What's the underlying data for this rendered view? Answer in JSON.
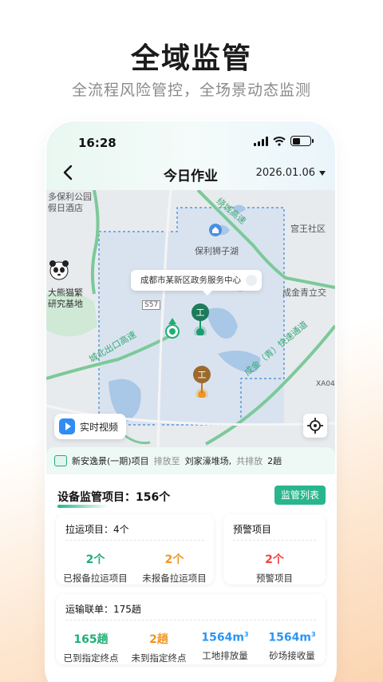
{
  "hero": {
    "title": "全域监管",
    "subtitle": "全流程风险管控，全场景动态监测"
  },
  "status_bar": {
    "time": "16:28"
  },
  "nav": {
    "title": "今日作业",
    "date": "2026.01.06"
  },
  "map": {
    "labels": [
      "多保利公园",
      "假日酒店",
      "绕城高速",
      "宫王社区",
      "保利狮子湖",
      "大熊猫繁",
      "研究基地",
      "成金青立交",
      "S57",
      "城北出口高速",
      "成金（青）快速通道",
      "XA04"
    ],
    "site_name": "成都市某新区政务服务中心",
    "marker_glyph": "工",
    "video_button": "实时视频"
  },
  "notice": {
    "project": "新安逸景(一期)项目",
    "dest_prefix": "排放至",
    "dest": "刘家濠堆场,",
    "count_prefix": "共排放",
    "count": "2趟"
  },
  "summary": {
    "title": "设备监管项目：156个",
    "list_button": "监管列表"
  },
  "transport_card": {
    "title": "拉运项目：4个",
    "metrics": [
      {
        "value": "2个",
        "label": "已报备拉运项目"
      },
      {
        "value": "2个",
        "label": "未报备拉运项目"
      }
    ]
  },
  "warning_card": {
    "title": "预警项目",
    "value": "2个",
    "label": "预警项目"
  },
  "waybill_card": {
    "title": "运输联单：175趟",
    "metrics": [
      {
        "value": "165趟",
        "label": "已到指定终点"
      },
      {
        "value": "2趟",
        "label": "未到指定终点"
      },
      {
        "value": "1564m",
        "unit": "3",
        "label": "工地排放量"
      },
      {
        "value": "1564m",
        "unit": "3",
        "label": "砂场接收量"
      }
    ]
  },
  "colors": {
    "accent": "#29b58e",
    "green": "#1eaf72",
    "orange": "#f2961e",
    "red": "#f0433c",
    "blue": "#2b96f3"
  }
}
